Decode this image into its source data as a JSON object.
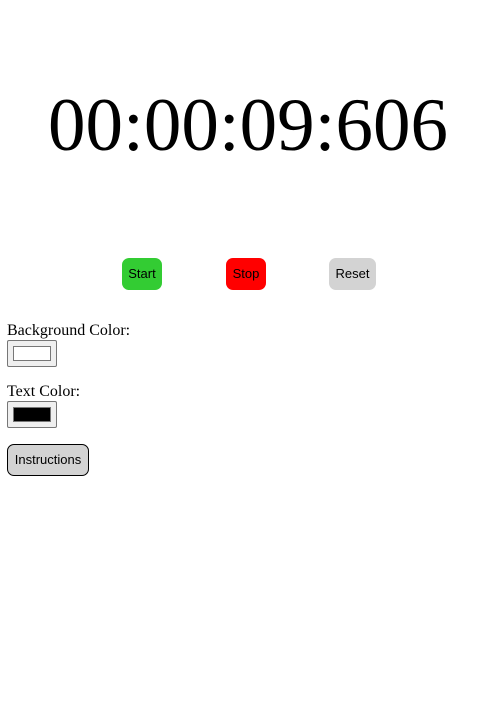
{
  "timer": {
    "display": "00:00:09:606"
  },
  "controls": {
    "start_label": "Start",
    "stop_label": "Stop",
    "reset_label": "Reset"
  },
  "settings": {
    "background_label": "Background Color:",
    "background_value": "#ffffff",
    "text_label": "Text Color:",
    "text_value": "#000000"
  },
  "instructions": {
    "label": "Instructions"
  },
  "colors": {
    "start": "#33cc33",
    "stop": "#ff0000",
    "reset": "#d3d3d3"
  }
}
